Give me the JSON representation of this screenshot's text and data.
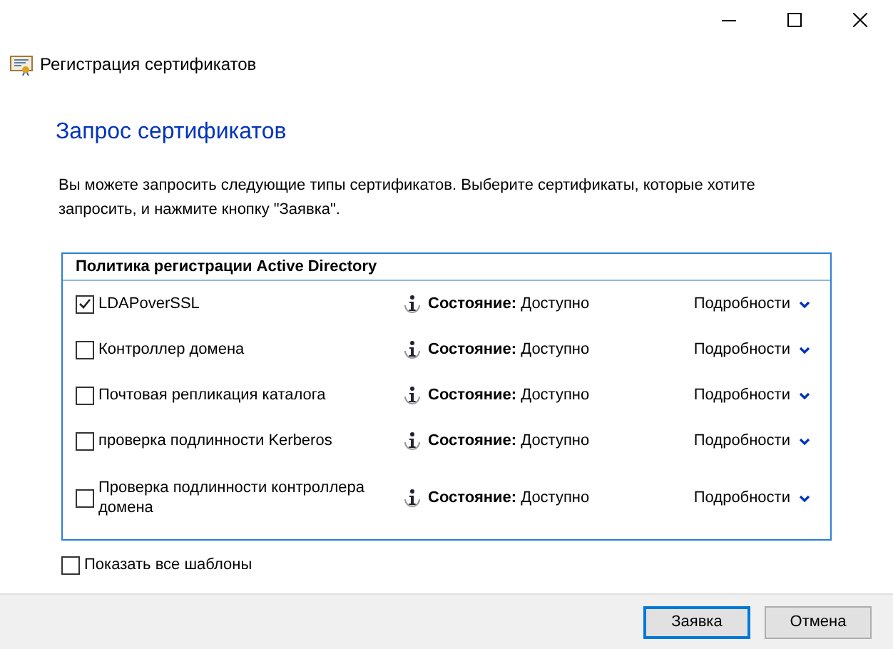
{
  "window": {
    "title": "Регистрация сертификатов"
  },
  "heading": "Запрос сертификатов",
  "description": "Вы можете запросить следующие типы сертификатов. Выберите сертификаты, которые хотите запросить, и нажмите кнопку \"Заявка\".",
  "policy": {
    "title": "Политика регистрации Active Directory",
    "items": [
      {
        "name": "LDAPoverSSL",
        "checked": true,
        "status": "**Состояние:** Доступно",
        "details": "Подробности"
      },
      {
        "name": "Контроллер домена",
        "checked": false,
        "status": "**Состояние:** Доступно",
        "details": "Подробности"
      },
      {
        "name": "Почтовая репликация каталога",
        "checked": false,
        "status": "**Состояние:** Доступно",
        "details": "Подробности"
      },
      {
        "name": "проверка подлинности Kerberos",
        "checked": false,
        "status": "**Состояние:** Доступно",
        "details": "Подробности"
      },
      {
        "name": "Проверка подлинности контроллера домена",
        "checked": false,
        "status": "**Состояние:** Доступно",
        "details": "Подробности"
      }
    ]
  },
  "show_all": {
    "label": "Показать все шаблоны",
    "checked": false
  },
  "buttons": [
    {
      "label": "Заявка",
      "default": true
    },
    {
      "label": "Отмена",
      "default": false
    }
  ]
}
